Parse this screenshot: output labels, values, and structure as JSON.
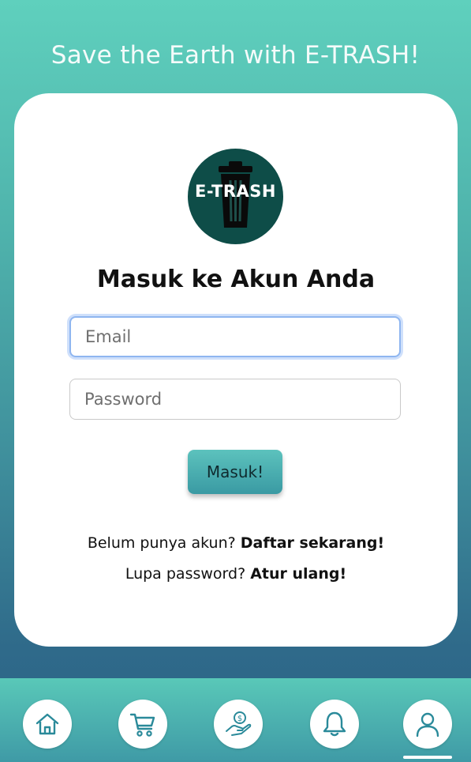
{
  "header": {
    "tagline": "Save the Earth with E-TRASH!"
  },
  "login": {
    "logo_text": "E-TRASH",
    "title": "Masuk ke Akun Anda",
    "email_placeholder": "Email",
    "password_placeholder": "Password",
    "submit_label": "Masuk!",
    "register_prompt": "Belum punya akun?",
    "register_link": "Daftar sekarang!",
    "forgot_prompt": "Lupa password?",
    "forgot_link": "Atur ulang!"
  },
  "bottom_nav": {
    "items": [
      {
        "icon": "home-icon"
      },
      {
        "icon": "cart-icon"
      },
      {
        "icon": "money-hand-icon"
      },
      {
        "icon": "bell-icon"
      },
      {
        "icon": "user-icon",
        "active": true
      }
    ]
  },
  "colors": {
    "logo_bg": "#0e4d48",
    "button": "#3a9aa3",
    "accent_teal": "#5fd0bd",
    "nav_icon": "#2a8a9a"
  }
}
